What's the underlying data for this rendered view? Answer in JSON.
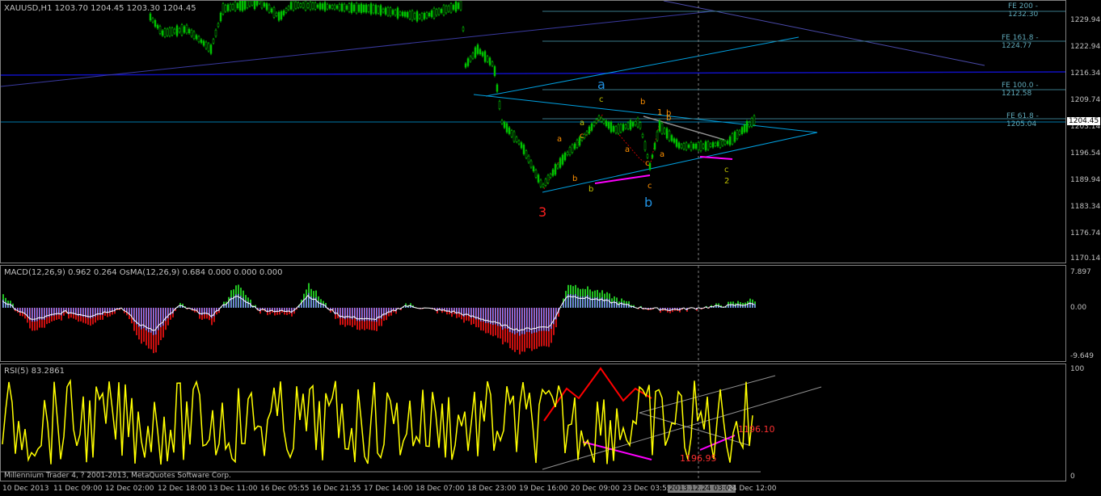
{
  "main": {
    "title": "XAUUSD,H1  1203.70 1204.45 1203.30 1204.45",
    "price_axis": [
      "1229.94",
      "1222.94",
      "1216.34",
      "1209.74",
      "1203.14",
      "1196.54",
      "1189.94",
      "1183.34",
      "1176.74",
      "1170.14"
    ],
    "current_price": "1204.45",
    "fib_levels": [
      "FE 200 - 1232.30",
      "FE 161.8 - 1224.77",
      "FE 100.0 - 1212.58",
      "FE 61.8 - 1205.04"
    ],
    "big_labels": {
      "three": "3",
      "a": "a",
      "b": "b"
    },
    "small_labels": [
      "c",
      "a",
      "b",
      "c",
      "a",
      "b",
      "c",
      "b",
      "1",
      "b",
      "a",
      "c",
      "a",
      "b",
      "c",
      "2"
    ]
  },
  "macd": {
    "title": "MACD(12,26,9) 0.962 0.264  OsMA(12,26,9) 0.684 0.000 0.000 0.000",
    "axis": [
      "7.897",
      "0.00",
      "-9.649"
    ]
  },
  "rsi": {
    "title": "RSI(5) 83.2861",
    "axis": [
      "100",
      "0"
    ],
    "annotations": [
      "1196.10",
      "1196.95"
    ],
    "copyright": "Millennium Trader 4, ? 2001-2013, MetaQuotes Software Corp."
  },
  "time_axis": [
    "10 Dec 2013",
    "11 Dec 09:00",
    "12 Dec 02:00",
    "12 Dec 18:00",
    "13 Dec 11:00",
    "16 Dec 05:55",
    "16 Dec 21:55",
    "17 Dec 14:00",
    "18 Dec 07:00",
    "18 Dec 23:00",
    "19 Dec 16:00",
    "20 Dec 09:00",
    "23 Dec 03:55",
    "2013.12.24 03:00",
    "24 Dec 12:00"
  ],
  "colors": {
    "bull": "#00c000",
    "bear": "#c00000",
    "trend": "#00a0e0",
    "pink": "#ff00ff",
    "yellow": "#ffff00",
    "darkblue": "#1010c0"
  }
}
